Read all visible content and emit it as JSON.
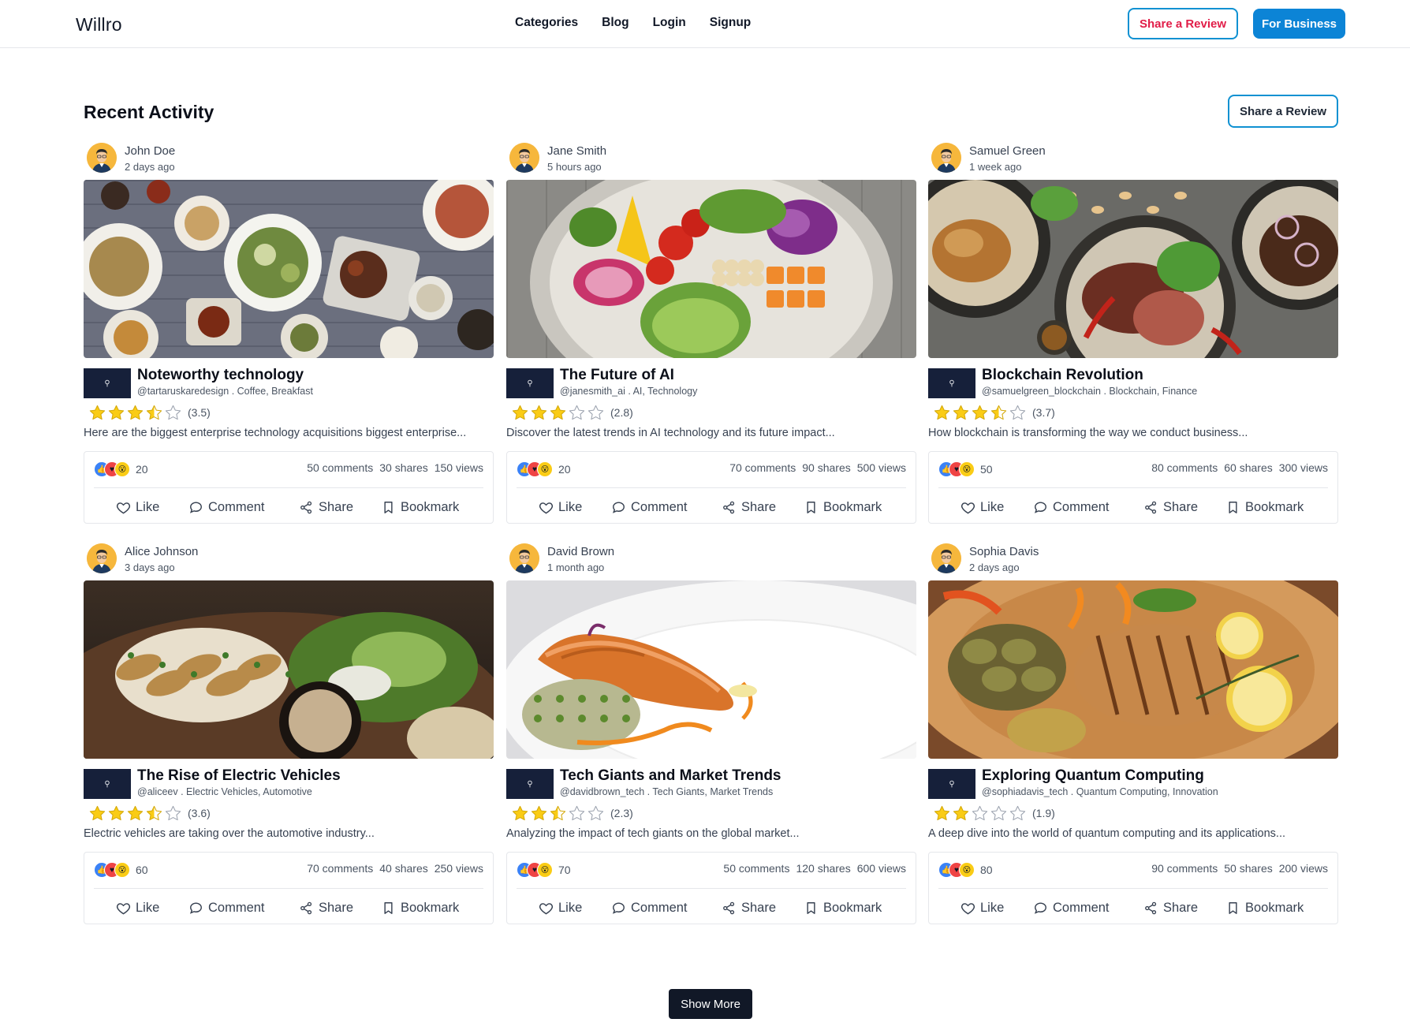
{
  "header": {
    "brand": "Willro",
    "nav": [
      "Categories",
      "Blog",
      "Login",
      "Signup"
    ],
    "share_review": "Share a Review",
    "for_business": "For Business"
  },
  "section": {
    "title": "Recent Activity",
    "share_review": "Share a Review"
  },
  "actions": {
    "like": "Like",
    "comment": "Comment",
    "share": "Share",
    "bookmark": "Bookmark"
  },
  "colors": {
    "star": "#facc15",
    "accent": "#0c84d6",
    "share_review_text": "#e11d48",
    "dark_button": "#111827"
  },
  "posts": [
    {
      "author": "John Doe",
      "time": "2 days ago",
      "title": "Noteworthy technology",
      "meta": "@tartaruskaredesign . Coffee, Breakfast",
      "rating": 3.5,
      "rating_label": "(3.5)",
      "description": "Here are the biggest enterprise technology acquisitions biggest enterprise...",
      "reactions": "20",
      "comments": "50 comments",
      "shares": "30 shares",
      "views": "150 views",
      "image": "food-platter-overhead"
    },
    {
      "author": "Jane Smith",
      "time": "5 hours ago",
      "title": "The Future of AI",
      "meta": "@janesmith_ai . AI, Technology",
      "rating": 2.8,
      "rating_label": "(2.8)",
      "description": "Discover the latest trends in AI technology and its future impact...",
      "reactions": "20",
      "comments": "70 comments",
      "shares": "90 shares",
      "views": "500 views",
      "image": "salad-bowl"
    },
    {
      "author": "Samuel Green",
      "time": "1 week ago",
      "title": "Blockchain Revolution",
      "meta": "@samuelgreen_blockchain . Blockchain, Finance",
      "rating": 3.7,
      "rating_label": "(3.7)",
      "description": "How blockchain is transforming the way we conduct business...",
      "reactions": "50",
      "comments": "80 comments",
      "shares": "60 shares",
      "views": "300 views",
      "image": "steak-plates"
    },
    {
      "author": "Alice Johnson",
      "time": "3 days ago",
      "title": "The Rise of Electric Vehicles",
      "meta": "@aliceev . Electric Vehicles, Automotive",
      "rating": 3.6,
      "rating_label": "(3.6)",
      "description": "Electric vehicles are taking over the automotive industry...",
      "reactions": "60",
      "comments": "70 comments",
      "shares": "40 shares",
      "views": "250 views",
      "image": "grilled-squid-salad"
    },
    {
      "author": "David Brown",
      "time": "1 month ago",
      "title": "Tech Giants and Market Trends",
      "meta": "@davidbrown_tech . Tech Giants, Market Trends",
      "rating": 2.3,
      "rating_label": "(2.3)",
      "description": "Analyzing the impact of tech giants on the global market...",
      "reactions": "70",
      "comments": "50 comments",
      "shares": "120 shares",
      "views": "600 views",
      "image": "salmon-plate"
    },
    {
      "author": "Sophia Davis",
      "time": "2 days ago",
      "title": "Exploring Quantum Computing",
      "meta": "@sophiadavis_tech . Quantum Computing, Innovation",
      "rating": 1.9,
      "rating_label": "(1.9)",
      "description": "A deep dive into the world of quantum computing and its applications...",
      "reactions": "80",
      "comments": "90 comments",
      "shares": "50 shares",
      "views": "200 views",
      "image": "grilled-chicken-board"
    }
  ],
  "show_more": "Show More"
}
